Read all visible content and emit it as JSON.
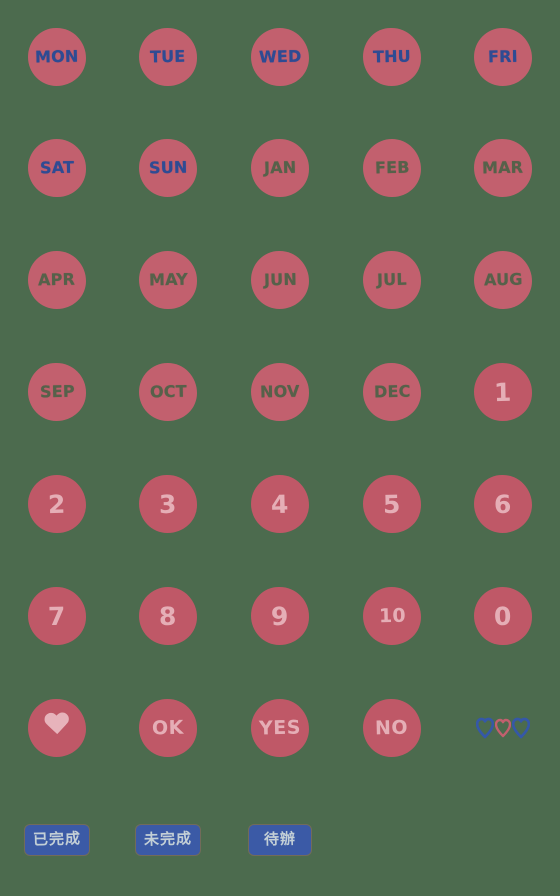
{
  "sheet": {
    "background_color": "#4c6b4e",
    "sticker_color": "#c2606e",
    "columns": 5,
    "rows": 8,
    "stickers": [
      {
        "id": "mon",
        "label": "MON",
        "kind": "circle-text",
        "text_color": "#2e4b93",
        "style": "navy",
        "row": 1,
        "col": 1
      },
      {
        "id": "tue",
        "label": "TUE",
        "kind": "circle-text",
        "text_color": "#2e4b93",
        "style": "navy",
        "row": 1,
        "col": 2
      },
      {
        "id": "wed",
        "label": "WED",
        "kind": "circle-text",
        "text_color": "#2e4b93",
        "style": "navy",
        "row": 1,
        "col": 3
      },
      {
        "id": "thu",
        "label": "THU",
        "kind": "circle-text",
        "text_color": "#2e4b93",
        "style": "navy",
        "row": 1,
        "col": 4
      },
      {
        "id": "fri",
        "label": "FRI",
        "kind": "circle-text",
        "text_color": "#2e4b93",
        "style": "navy",
        "row": 1,
        "col": 5
      },
      {
        "id": "sat",
        "label": "SAT",
        "kind": "circle-text",
        "text_color": "#2e4b93",
        "style": "navy",
        "row": 2,
        "col": 1
      },
      {
        "id": "sun",
        "label": "SUN",
        "kind": "circle-text",
        "text_color": "#2e4b93",
        "style": "navy",
        "row": 2,
        "col": 2
      },
      {
        "id": "jan",
        "label": "JAN",
        "kind": "circle-text",
        "text_color": "#56614a",
        "style": "olive",
        "row": 2,
        "col": 3
      },
      {
        "id": "feb",
        "label": "FEB",
        "kind": "circle-text",
        "text_color": "#56614a",
        "style": "olive",
        "row": 2,
        "col": 4
      },
      {
        "id": "mar",
        "label": "MAR",
        "kind": "circle-text",
        "text_color": "#56614a",
        "style": "olive",
        "row": 2,
        "col": 5
      },
      {
        "id": "apr",
        "label": "APR",
        "kind": "circle-text",
        "text_color": "#56614a",
        "style": "olive",
        "row": 3,
        "col": 1
      },
      {
        "id": "may",
        "label": "MAY",
        "kind": "circle-text",
        "text_color": "#56614a",
        "style": "olive",
        "row": 3,
        "col": 2
      },
      {
        "id": "jun",
        "label": "JUN",
        "kind": "circle-text",
        "text_color": "#56614a",
        "style": "olive",
        "row": 3,
        "col": 3
      },
      {
        "id": "jul",
        "label": "JUL",
        "kind": "circle-text",
        "text_color": "#56614a",
        "style": "olive",
        "row": 3,
        "col": 4
      },
      {
        "id": "aug",
        "label": "AUG",
        "kind": "circle-text",
        "text_color": "#56614a",
        "style": "olive",
        "row": 3,
        "col": 5
      },
      {
        "id": "sep",
        "label": "SEP",
        "kind": "circle-text",
        "text_color": "#56614a",
        "style": "olive",
        "row": 4,
        "col": 1
      },
      {
        "id": "oct",
        "label": "OCT",
        "kind": "circle-text",
        "text_color": "#56614a",
        "style": "olive",
        "row": 4,
        "col": 2
      },
      {
        "id": "nov",
        "label": "NOV",
        "kind": "circle-text",
        "text_color": "#56614a",
        "style": "olive",
        "row": 4,
        "col": 3
      },
      {
        "id": "dec",
        "label": "DEC",
        "kind": "circle-text",
        "text_color": "#56614a",
        "style": "olive",
        "row": 4,
        "col": 4
      },
      {
        "id": "num-1",
        "label": "1",
        "kind": "circle-text",
        "text_color": "#e5aeb6",
        "style": "pink",
        "row": 4,
        "col": 5
      },
      {
        "id": "num-2",
        "label": "2",
        "kind": "circle-text",
        "text_color": "#e5aeb6",
        "style": "pink",
        "row": 5,
        "col": 1
      },
      {
        "id": "num-3",
        "label": "3",
        "kind": "circle-text",
        "text_color": "#e5aeb6",
        "style": "pink",
        "row": 5,
        "col": 2
      },
      {
        "id": "num-4",
        "label": "4",
        "kind": "circle-text",
        "text_color": "#e5aeb6",
        "style": "pink",
        "row": 5,
        "col": 3
      },
      {
        "id": "num-5",
        "label": "5",
        "kind": "circle-text",
        "text_color": "#e5aeb6",
        "style": "pink",
        "row": 5,
        "col": 4
      },
      {
        "id": "num-6",
        "label": "6",
        "kind": "circle-text",
        "text_color": "#e5aeb6",
        "style": "pink",
        "row": 5,
        "col": 5
      },
      {
        "id": "num-7",
        "label": "7",
        "kind": "circle-text",
        "text_color": "#e5aeb6",
        "style": "pink",
        "row": 6,
        "col": 1
      },
      {
        "id": "num-8",
        "label": "8",
        "kind": "circle-text",
        "text_color": "#e5aeb6",
        "style": "pink",
        "row": 6,
        "col": 2
      },
      {
        "id": "num-9",
        "label": "9",
        "kind": "circle-text",
        "text_color": "#e5aeb6",
        "style": "pink",
        "row": 6,
        "col": 3
      },
      {
        "id": "num-10",
        "label": "10",
        "kind": "circle-text",
        "text_color": "#e5aeb6",
        "style": "pink ten",
        "row": 6,
        "col": 4
      },
      {
        "id": "num-0",
        "label": "0",
        "kind": "circle-text",
        "text_color": "#e5aeb6",
        "style": "pink",
        "row": 6,
        "col": 5
      },
      {
        "id": "heart",
        "label": "",
        "icon": "heart-icon",
        "kind": "circle-heart",
        "text_color": "#e7b3bb",
        "style": "pink",
        "row": 7,
        "col": 1
      },
      {
        "id": "ok",
        "label": "OK",
        "kind": "circle-text",
        "text_color": "#e5aeb6",
        "style": "pink word",
        "row": 7,
        "col": 2
      },
      {
        "id": "yes",
        "label": "YES",
        "kind": "circle-text",
        "text_color": "#e5aeb6",
        "style": "pink word",
        "row": 7,
        "col": 3
      },
      {
        "id": "no",
        "label": "NO",
        "kind": "circle-text",
        "text_color": "#e5aeb6",
        "style": "pink word",
        "row": 7,
        "col": 4
      },
      {
        "id": "tri-hearts",
        "label": "",
        "icon": "three-hearts-icon",
        "kind": "tri-hearts",
        "row": 7,
        "col": 5
      }
    ],
    "tri_heart_colors": [
      "#3558a8",
      "#c2606e",
      "#3558a8"
    ],
    "badges": [
      {
        "id": "badge-done",
        "label": "已完成",
        "bg_color": "#3b5aa6",
        "text_color": "#c3cfd6",
        "col": 1
      },
      {
        "id": "badge-not-done",
        "label": "未完成",
        "bg_color": "#3b5aa6",
        "text_color": "#c3cfd6",
        "col": 2
      },
      {
        "id": "badge-todo",
        "label": "待辦",
        "bg_color": "#3b5aa6",
        "text_color": "#c3cfd6",
        "col": 3
      }
    ]
  }
}
